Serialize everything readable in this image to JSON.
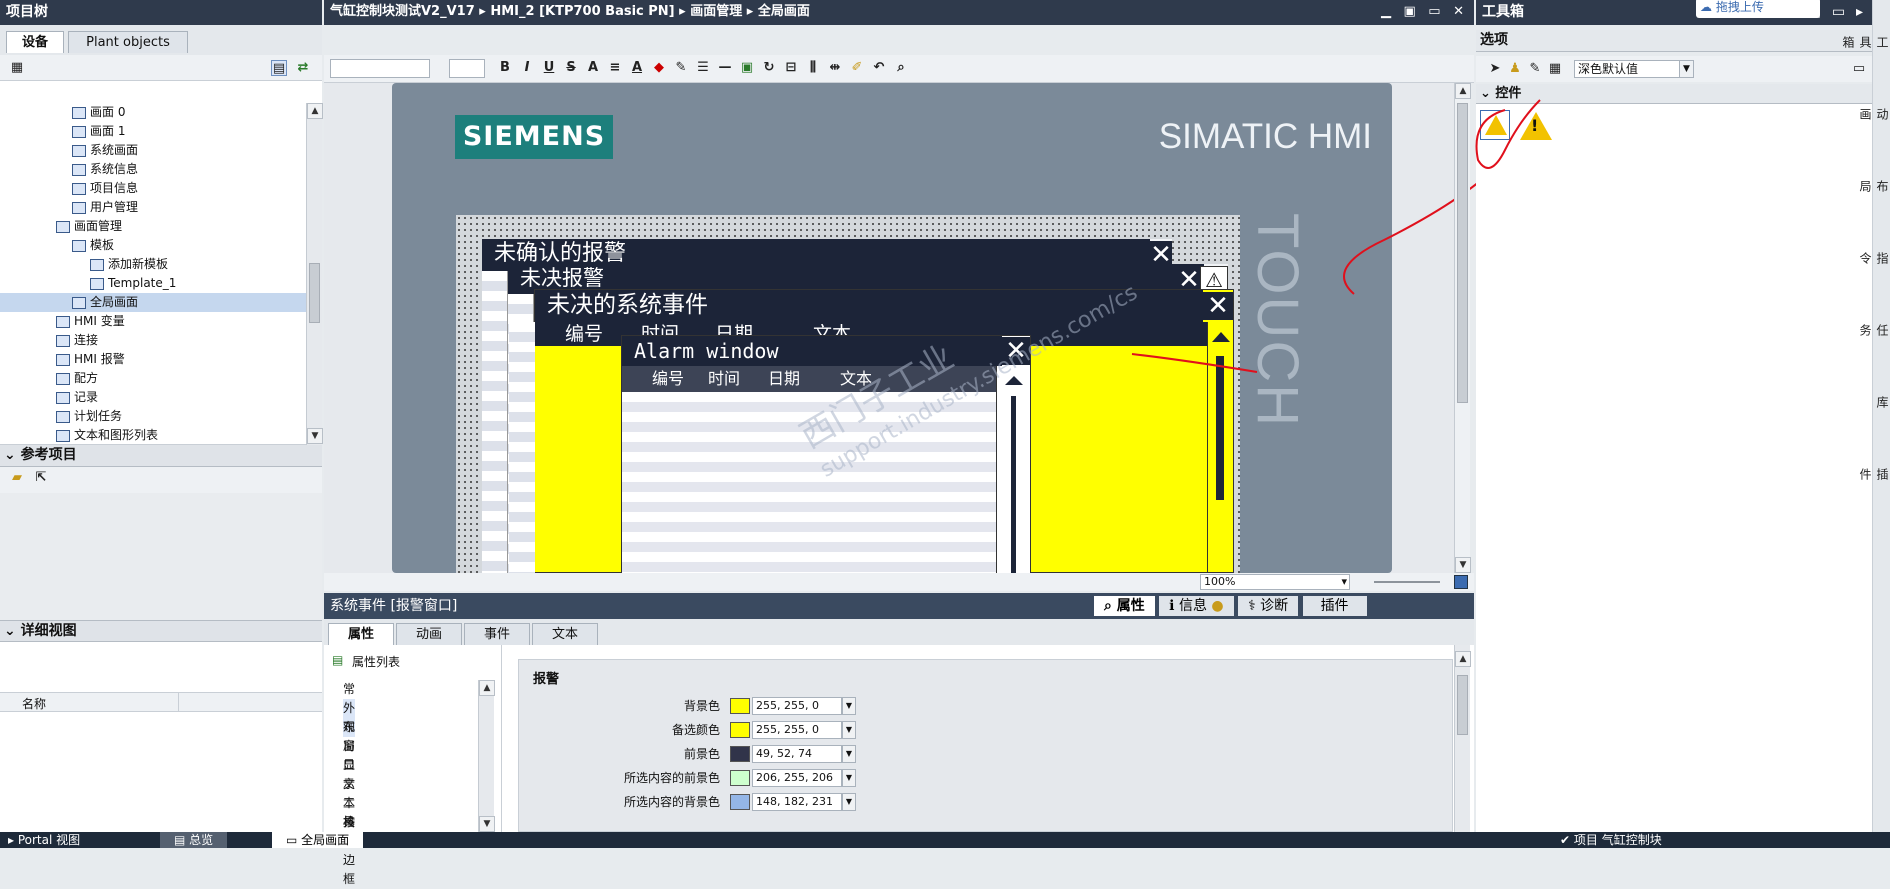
{
  "project_tree": {
    "title": "项目树",
    "tabs": [
      "设备",
      "Plant objects"
    ],
    "items": [
      {
        "label": "画面 0",
        "indent": 72
      },
      {
        "label": "画面 1",
        "indent": 72
      },
      {
        "label": "系统画面",
        "indent": 72
      },
      {
        "label": "系统信息",
        "indent": 72
      },
      {
        "label": "项目信息",
        "indent": 72
      },
      {
        "label": "用户管理",
        "indent": 72
      },
      {
        "label": "画面管理",
        "indent": 56
      },
      {
        "label": "模板",
        "indent": 72
      },
      {
        "label": "添加新模板",
        "indent": 90
      },
      {
        "label": "Template_1",
        "indent": 90
      },
      {
        "label": "全局画面",
        "indent": 72
      },
      {
        "label": "HMI 变量",
        "indent": 56
      },
      {
        "label": "连接",
        "indent": 56
      },
      {
        "label": "HMI 报警",
        "indent": 56
      },
      {
        "label": "配方",
        "indent": 56
      },
      {
        "label": "记录",
        "indent": 56
      },
      {
        "label": "计划任务",
        "indent": 56
      },
      {
        "label": "文本和图形列表",
        "indent": 56
      }
    ]
  },
  "reference": {
    "title": "参考项目"
  },
  "detail": {
    "title": "详细视图",
    "col_name": "名称"
  },
  "breadcrumb": [
    "气缸控制块测试V2_V17",
    "HMI_2 [KTP700 Basic PN]",
    "画面管理",
    "全局画面"
  ],
  "hmi": {
    "brand": "SIEMENS",
    "product": "SIMATIC HMI",
    "touch": "TOUCH",
    "zoom": "100%"
  },
  "alarm_windows": {
    "unack": "未确认的报警",
    "pending": "未决报警",
    "sysevents": "未决的系统事件",
    "alarm": "Alarm window",
    "cols_cn": [
      "编号",
      "时间",
      "日期",
      "文本"
    ]
  },
  "watermark": {
    "line1": "西门子工业",
    "line2": "support.industry.siemens.com/cs"
  },
  "inspector": {
    "title": "系统事件 [报警窗口]",
    "tabs": [
      "属性",
      "动画",
      "事件",
      "文本"
    ],
    "right_tabs": [
      "属性",
      "信息",
      "诊断",
      "插件"
    ],
    "prop_list_title": "属性列表",
    "prop_items": [
      "常规",
      "外观",
      "布局",
      "窗口",
      "显示",
      "文本格式",
      "工具栏",
      "按钮边框"
    ],
    "section": "报警",
    "colors": [
      {
        "label": "背景色",
        "value": "255, 255, 0",
        "hex": "#ffff00"
      },
      {
        "label": "备选颜色",
        "value": "255, 255, 0",
        "hex": "#ffff00"
      },
      {
        "label": "前景色",
        "value": "49, 52, 74",
        "hex": "#31344a"
      },
      {
        "label": "所选内容的前景色",
        "value": "206, 255, 206",
        "hex": "#ceffce"
      },
      {
        "label": "所选内容的背景色",
        "value": "148, 182, 231",
        "hex": "#94b6e7"
      }
    ]
  },
  "toolbox": {
    "title": "工具箱",
    "options": "选项",
    "select_value": "深色默认值",
    "controls": "控件",
    "upload": "拖拽上传"
  },
  "right_side": [
    "工具箱",
    "动画",
    "布局",
    "指令",
    "任务",
    "库",
    "插件"
  ],
  "taskbar": {
    "portal": "Portal 视图",
    "overview": "总览",
    "global": "全局画面",
    "project": "项目 气缸控制块"
  }
}
